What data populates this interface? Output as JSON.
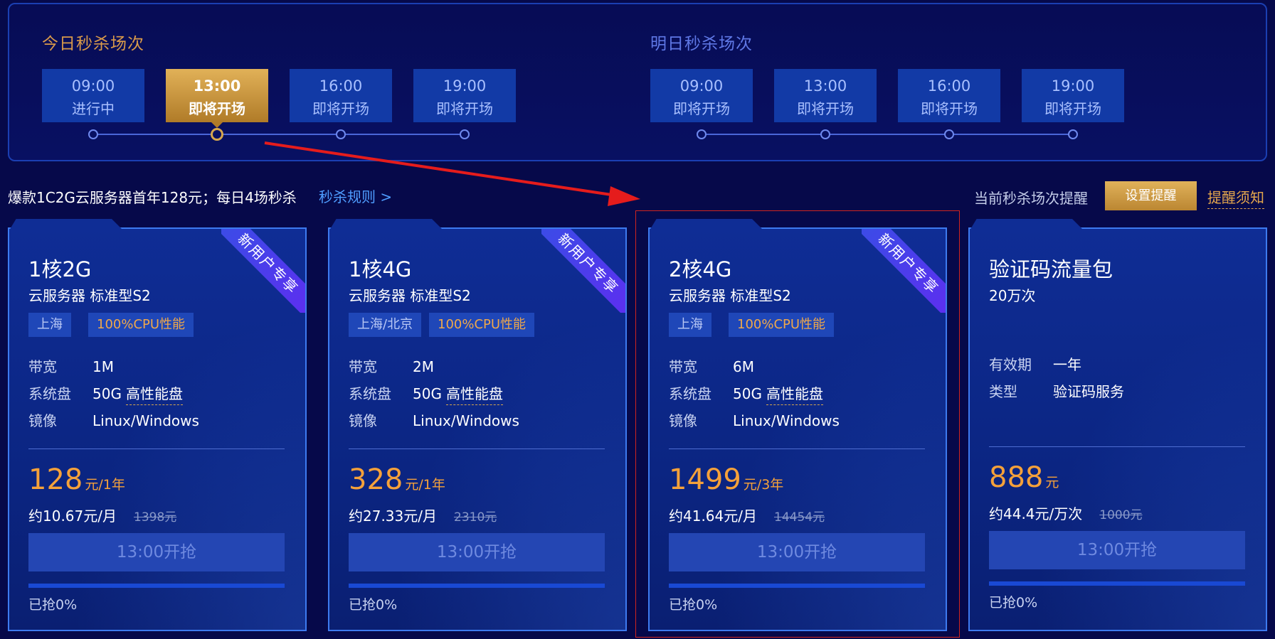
{
  "schedule": {
    "today_title": "今日秒杀场次",
    "tomorrow_title": "明日秒杀场次",
    "today_slots": [
      {
        "time": "09:00",
        "status": "进行中"
      },
      {
        "time": "13:00",
        "status": "即将开场"
      },
      {
        "time": "16:00",
        "status": "即将开场"
      },
      {
        "time": "19:00",
        "status": "即将开场"
      }
    ],
    "tomorrow_slots": [
      {
        "time": "09:00",
        "status": "即将开场"
      },
      {
        "time": "13:00",
        "status": "即将开场"
      },
      {
        "time": "16:00",
        "status": "即将开场"
      },
      {
        "time": "19:00",
        "status": "即将开场"
      }
    ],
    "active_slot": "today-13:00"
  },
  "info_bar": {
    "promo": "爆款1C2G云服务器首年128元；每日4场秒杀",
    "rules_link": "秒杀规则 >",
    "reminder_label": "当前秒杀场次提醒",
    "reminder_button": "设置提醒",
    "notice_link": "提醒须知"
  },
  "colors": {
    "accent_gold": "#d7a74d",
    "price_orange": "#f5a13a",
    "highlight_red": "#d0241e",
    "arrow_red": "#e51c1c"
  },
  "cards": [
    {
      "ribbon": "新用户专享",
      "title": "1核2G",
      "subtitle": "云服务器 标准型S2",
      "region": "上海",
      "cpu": "100%CPU性能",
      "specs": [
        {
          "k": "带宽",
          "v": "1M"
        },
        {
          "k": "系统盘",
          "v": "50G",
          "u": "高性能盘"
        },
        {
          "k": "镜像",
          "v": "Linux/Windows"
        }
      ],
      "price": "128",
      "price_unit": "元/1年",
      "monthly": "约10.67元/月",
      "original": "1398元",
      "button": "13:00开抢",
      "sold": "已抢0%",
      "sold_fraction": 0
    },
    {
      "ribbon": "新用户专享",
      "title": "1核4G",
      "subtitle": "云服务器 标准型S2",
      "region": "上海/北京",
      "cpu": "100%CPU性能",
      "specs": [
        {
          "k": "带宽",
          "v": "2M"
        },
        {
          "k": "系统盘",
          "v": "50G",
          "u": "高性能盘"
        },
        {
          "k": "镜像",
          "v": "Linux/Windows"
        }
      ],
      "price": "328",
      "price_unit": "元/1年",
      "monthly": "约27.33元/月",
      "original": "2310元",
      "button": "13:00开抢",
      "sold": "已抢0%",
      "sold_fraction": 0
    },
    {
      "ribbon": "新用户专享",
      "title": "2核4G",
      "subtitle": "云服务器 标准型S2",
      "region": "上海",
      "cpu": "100%CPU性能",
      "specs": [
        {
          "k": "带宽",
          "v": "6M"
        },
        {
          "k": "系统盘",
          "v": "50G",
          "u": "高性能盘"
        },
        {
          "k": "镜像",
          "v": "Linux/Windows"
        }
      ],
      "price": "1499",
      "price_unit": "元/3年",
      "monthly": "约41.64元/月",
      "original": "14454元",
      "button": "13:00开抢",
      "sold": "已抢0%",
      "sold_fraction": 0
    },
    {
      "title": "验证码流量包",
      "subtitle": "20万次",
      "specs": [
        {
          "k": "有效期",
          "v": "一年"
        },
        {
          "k": "类型",
          "v": "验证码服务"
        }
      ],
      "price": "888",
      "price_unit": "元",
      "monthly": "约44.4元/万次",
      "original": "1000元",
      "button": "13:00开抢",
      "sold": "已抢0%",
      "sold_fraction": 0
    }
  ]
}
